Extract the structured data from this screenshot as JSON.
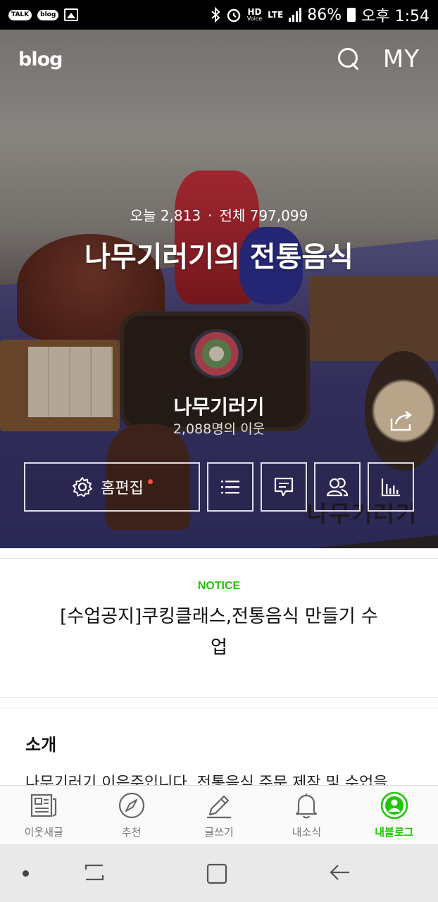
{
  "status_bar": {
    "apps": [
      "TALK",
      "blog"
    ],
    "hd": "HD",
    "hd_sub": "Voice",
    "lte": "LTE",
    "battery": "86%",
    "time": "오후 1:54"
  },
  "header": {
    "logo": "blog",
    "my_label": "MY"
  },
  "hero": {
    "today_label": "오늘 2,813",
    "separator": "·",
    "total_label": "전체 797,099",
    "title": "나무기러기의 전통음식",
    "nickname": "나무기러기",
    "neighbors": "2,088명의 이웃",
    "watermark": "나무기러기"
  },
  "actions": {
    "home_edit": "홈편집",
    "icons": [
      "list-icon",
      "comment-icon",
      "neighbors-icon",
      "stats-icon"
    ]
  },
  "notice": {
    "label": "NOTICE",
    "text": "[수업공지]쿠킹클래스,전통음식 만들기 수업"
  },
  "intro": {
    "title": "소개",
    "text": "나무기러기 이은주입니다. 전통음식 주문 제작 및 수업을"
  },
  "tabs": [
    {
      "label": "이웃새글",
      "icon": "news-icon",
      "active": false
    },
    {
      "label": "추천",
      "icon": "compass-icon",
      "active": false
    },
    {
      "label": "글쓰기",
      "icon": "pencil-icon",
      "active": false
    },
    {
      "label": "내소식",
      "icon": "bell-icon",
      "active": false
    },
    {
      "label": "내블로그",
      "icon": "profile-icon",
      "active": true
    }
  ],
  "colors": {
    "accent": "#1ec800",
    "notification_dot": "#ff4b3a"
  }
}
